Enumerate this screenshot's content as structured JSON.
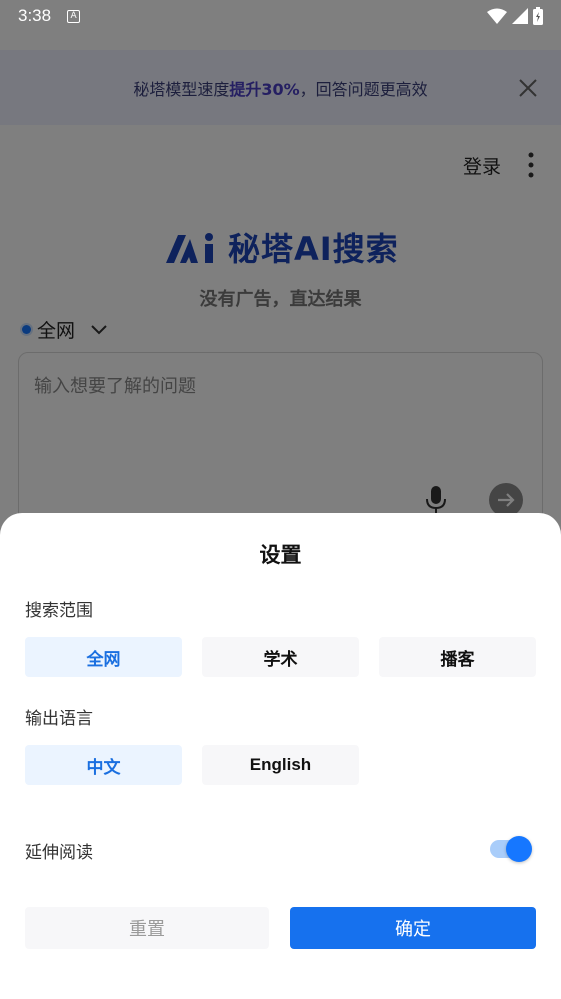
{
  "statusbar": {
    "time": "3:38",
    "notif_icon": "A"
  },
  "banner": {
    "text_pre": "秘塔模型速度",
    "text_bold": "提升30%",
    "text_post": "，回答问题更高效"
  },
  "header": {
    "login": "登录"
  },
  "brand": {
    "name": "秘塔AI搜索",
    "slogan": "没有广告，直达结果"
  },
  "scope": {
    "selected": "全网"
  },
  "search": {
    "placeholder": "输入想要了解的问题"
  },
  "sheet": {
    "title": "设置",
    "search_scope": {
      "label": "搜索范围",
      "options": [
        "全网",
        "学术",
        "播客"
      ],
      "selected": "全网"
    },
    "output_language": {
      "label": "输出语言",
      "options": [
        "中文",
        "English"
      ],
      "selected": "中文"
    },
    "extended_reading": {
      "label": "延伸阅读",
      "enabled": true
    },
    "reset_label": "重置",
    "confirm_label": "确定"
  },
  "colors": {
    "accent": "#1671ee",
    "brand": "#1c44b8",
    "chip_active_bg": "#ebf4ff"
  }
}
